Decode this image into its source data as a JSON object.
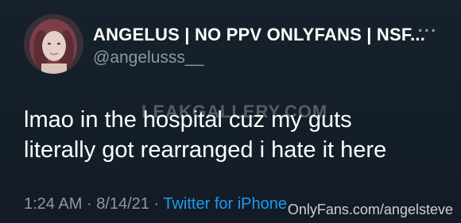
{
  "tweet": {
    "display_name": "ANGELUS | NO PPV ONLYFANS | NSF...",
    "handle": "@angelusss__",
    "more_label": "···",
    "text_lines": [
      "lmao in the hospital cuz my guts",
      "literally got rearranged i hate it here"
    ],
    "time": "1:24 AM",
    "date": "8/14/21",
    "separator": "·",
    "source": "Twitter for iPhone"
  },
  "watermarks": {
    "top": "LEAKGALLERY.COM",
    "bottom": "OnlyFans.com/angelsteve"
  },
  "colors": {
    "background": "#15202b",
    "text": "#ffffff",
    "muted": "#8b98a5",
    "accent": "#1d9bf0"
  },
  "icons": {
    "avatar": "profile-photo",
    "more": "more-dots-icon"
  }
}
